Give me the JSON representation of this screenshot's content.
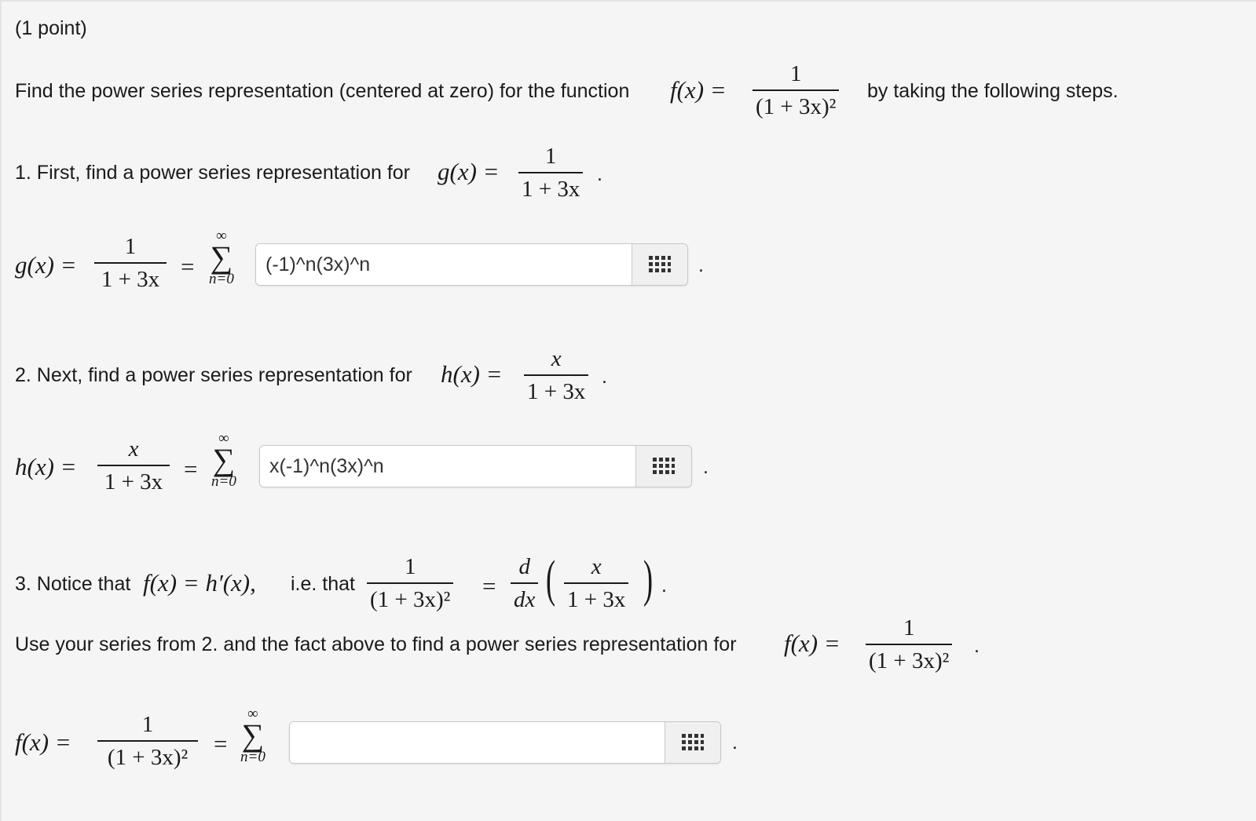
{
  "header": {
    "points": "(1 point)"
  },
  "intro": {
    "text_before": "Find the power series representation (centered at zero) for the function",
    "func": "f(x) =",
    "frac_num": "1",
    "frac_den": "(1 + 3x)²",
    "text_after": "by taking the following steps."
  },
  "step1": {
    "text": "1. First, find a power series representation for",
    "func": "g(x) =",
    "frac_num": "1",
    "frac_den": "1 + 3x",
    "period": ".",
    "eq_lhs": "g(x) =",
    "eq_num": "1",
    "eq_den": "1 + 3x",
    "eq_sign": "=",
    "sum_sup": "∞",
    "sum_sym": "∑",
    "sum_sub": "n=0",
    "answer_value": "(-1)^n(3x)^n",
    "trail": "."
  },
  "step2": {
    "text": "2. Next, find a power series representation for",
    "func": "h(x) =",
    "frac_num": "x",
    "frac_den": "1 + 3x",
    "period": ".",
    "eq_lhs": "h(x) =",
    "eq_num": "x",
    "eq_den": "1 + 3x",
    "eq_sign": "=",
    "sum_sup": "∞",
    "sum_sym": "∑",
    "sum_sub": "n=0",
    "answer_value": "x(-1)^n(3x)^n",
    "trail": "."
  },
  "step3": {
    "text": "3. Notice that",
    "relation": "f(x) = h′(x),",
    "ie": "i.e. that",
    "lhs_num": "1",
    "lhs_den": "(1 + 3x)²",
    "eq_sign": "=",
    "d_num": "d",
    "d_den": "dx",
    "inner_num": "x",
    "inner_den": "1 + 3x",
    "period": ".",
    "use_text": "Use your series from 2. and the fact above to find a power series representation for",
    "use_func": "f(x) =",
    "use_num": "1",
    "use_den": "(1 + 3x)²",
    "use_period": ".",
    "eq_lhs": "f(x) =",
    "eq_num": "1",
    "eq_den": "(1 + 3x)²",
    "sum_sign": "=",
    "sum_sup": "∞",
    "sum_sym": "∑",
    "sum_sub": "n=0",
    "answer_value": "",
    "trail": "."
  }
}
